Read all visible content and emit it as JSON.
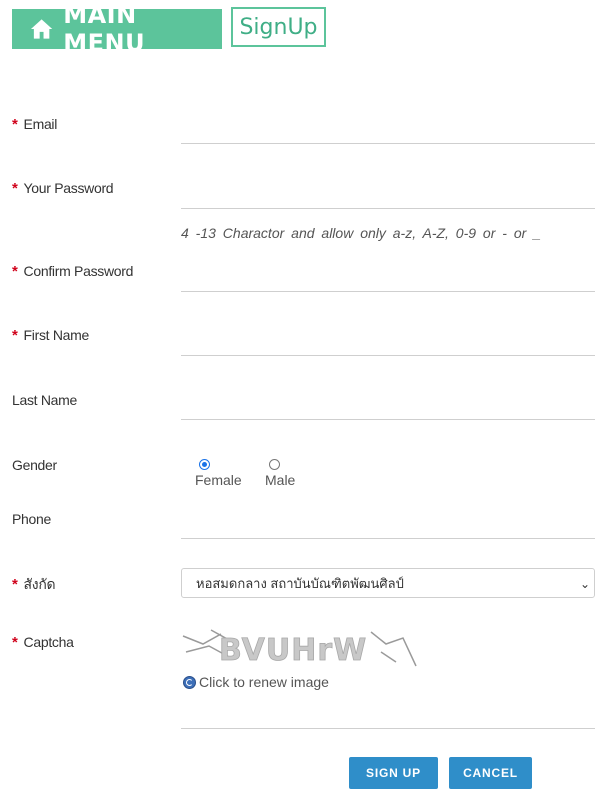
{
  "header": {
    "main_menu_label": "MAIN MENU",
    "signup_label": "SignUp"
  },
  "form": {
    "required_mark": "*",
    "email": {
      "label": "Email",
      "value": ""
    },
    "password": {
      "label": "Your Password",
      "value": ""
    },
    "password_hint": "4 -13 Charactor and allow only a-z, A-Z, 0-9 or - or _",
    "confirm_password": {
      "label": "Confirm Password",
      "value": ""
    },
    "first_name": {
      "label": "First Name",
      "value": ""
    },
    "last_name": {
      "label": "Last Name",
      "value": ""
    },
    "gender": {
      "label": "Gender",
      "options": [
        "Female",
        "Male"
      ],
      "selected": "Female"
    },
    "phone": {
      "label": "Phone",
      "value": ""
    },
    "affiliation": {
      "label": "สังกัด",
      "selected": "หอสมดกลาง สถาบันบัณฑิตพัฒนศิลป์"
    },
    "captcha": {
      "label": "Captcha",
      "image_text": "BVUHrW",
      "renew_label": "Click to renew image",
      "value": ""
    }
  },
  "buttons": {
    "signup_label": "SIGN UP",
    "cancel_label": "CANCEL"
  },
  "colors": {
    "accent_green": "#5cc49b",
    "button_blue": "#2f8ec9",
    "required_red": "#d0021b"
  }
}
